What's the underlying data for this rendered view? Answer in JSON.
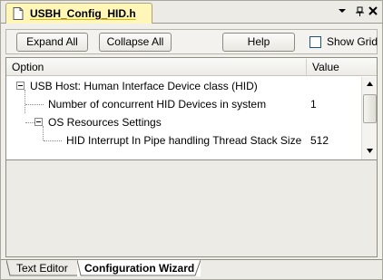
{
  "document_tab": {
    "title": "USBH_Config_HID.h",
    "icon": "file-icon"
  },
  "window_controls": {
    "dropdown_icon": "chevron-down-icon",
    "pin_icon": "pin-icon",
    "close_icon": "close-icon"
  },
  "toolbar": {
    "expand_all": "Expand All",
    "collapse_all": "Collapse All",
    "help": "Help",
    "show_grid": "Show Grid",
    "show_grid_checked": false
  },
  "grid": {
    "columns": {
      "option": "Option",
      "value": "Value"
    },
    "rows": [
      {
        "label": "USB Host: Human Interface Device class (HID)",
        "value": "",
        "expander": "minus"
      },
      {
        "label": "Number of concurrent HID Devices in system",
        "value": "1",
        "expander": ""
      },
      {
        "label": "OS Resources Settings",
        "value": "",
        "expander": "minus"
      },
      {
        "label": "HID Interrupt In Pipe handling Thread Stack Size",
        "value": "512",
        "expander": ""
      }
    ]
  },
  "bottom_tabs": {
    "text_editor": "Text Editor",
    "configuration_wizard": "Configuration Wizard",
    "active": "Configuration Wizard"
  },
  "colors": {
    "active_doc_tab": "#fff6b8",
    "tab_underline": "#e0b200",
    "panel_bg": "#ecebe5"
  }
}
